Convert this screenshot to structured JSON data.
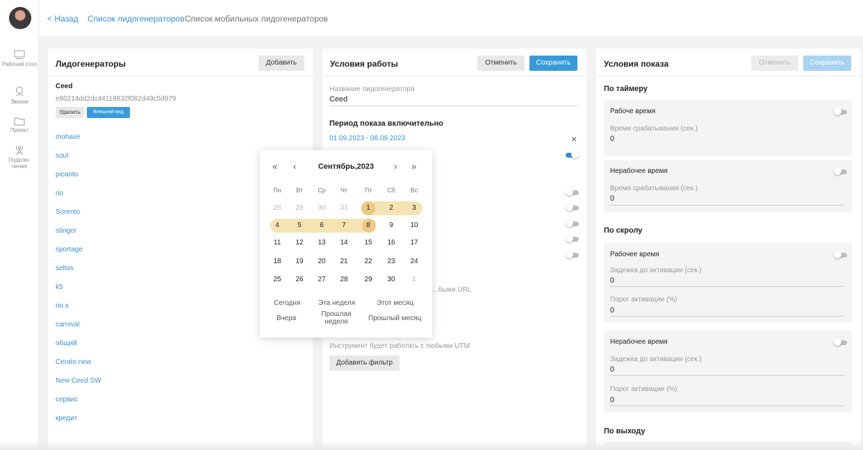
{
  "sidebar": {
    "items": [
      {
        "label": "Рабочий стол",
        "icon": "desktop-icon"
      },
      {
        "label": "Звонки",
        "icon": "headset-icon"
      },
      {
        "label": "Проект",
        "icon": "folder-icon"
      },
      {
        "label": "Подклю-чения",
        "icon": "antenna-icon"
      }
    ]
  },
  "header": {
    "back": "< Назад",
    "crumb1": "Список лидогенераторов",
    "crumb2": "Список мобильных лидогенераторов"
  },
  "left_panel": {
    "title": "Лидогенераторы",
    "add": "Добавить",
    "current": {
      "name": "Ceed",
      "id": "e80214dd2dc44118832f082d49c5d979",
      "delete": "Удалить",
      "appearance": "Внешний вид"
    },
    "items": [
      "mohave",
      "soul",
      "picanto",
      "rio",
      "Sorento",
      "stinger",
      "sportage",
      "seltos",
      "k5",
      "rio x",
      "carnival",
      "общий",
      "Cerato new",
      "New Ceed SW",
      "сервис",
      "кредит"
    ]
  },
  "middle_panel": {
    "title": "Условия работы",
    "cancel": "Отменить",
    "save": "Сохранить",
    "name_label": "Название лидогенератора",
    "name_value": "Ceed",
    "period_title": "Период показа включительно",
    "period_value": "01.09.2023 - 08.09.2023",
    "clear": "×",
    "url_hint": "...быми URL",
    "utm_hint": "Инструмент будет работать с любыми UTM",
    "add_filter": "Добавить фильтр"
  },
  "calendar": {
    "month": "Сентябрь,2023",
    "nav": {
      "prev_year": "«",
      "prev": "‹",
      "next": "›",
      "next_year": "»"
    },
    "weekdays": [
      "Пн",
      "Вт",
      "Ср",
      "Чт",
      "Пт",
      "Сб",
      "Вс"
    ],
    "weeks": [
      [
        "28",
        "29",
        "30",
        "31",
        "1",
        "2",
        "3"
      ],
      [
        "4",
        "5",
        "6",
        "7",
        "8",
        "9",
        "10"
      ],
      [
        "11",
        "12",
        "13",
        "14",
        "15",
        "16",
        "17"
      ],
      [
        "18",
        "19",
        "20",
        "21",
        "22",
        "23",
        "24"
      ],
      [
        "25",
        "26",
        "27",
        "28",
        "29",
        "30",
        "1"
      ]
    ],
    "quick": {
      "today": "Сегодня",
      "this_week": "Эта неделя",
      "this_month": "Этот месяц",
      "yesterday": "Вчера",
      "last_week": "Прошлая неделя",
      "last_month": "Прошлый месяц"
    },
    "colors": {
      "range": "#f6e3b2",
      "edge": "#eec983"
    }
  },
  "right_panel": {
    "title": "Условия показа",
    "cancel": "Отменить",
    "save": "Сохранить",
    "timer": {
      "title": "По таймеру",
      "work": {
        "label": "Рабоче время",
        "field_label": "Время срабатывания (сек.)",
        "value": "0"
      },
      "nonwork": {
        "label": "Нерабочее время",
        "field_label": "Время срабатывания (сек.)",
        "value": "0"
      }
    },
    "scroll": {
      "title": "По скролу",
      "work": {
        "label": "Рабочее время",
        "delay_label": "Задежка до активации (сек.)",
        "delay_value": "0",
        "threshold_label": "Порог активации (%)",
        "threshold_value": "0"
      },
      "nonwork": {
        "label": "Нерабочее время",
        "delay_label": "Задежка до активации (сек.)",
        "delay_value": "0",
        "threshold_label": "Порог активации (%)",
        "threshold_value": "0"
      }
    },
    "exit": {
      "title": "По выходу"
    }
  },
  "colors": {
    "accent": "#3a9ad9",
    "link": "#3a8fd1"
  }
}
